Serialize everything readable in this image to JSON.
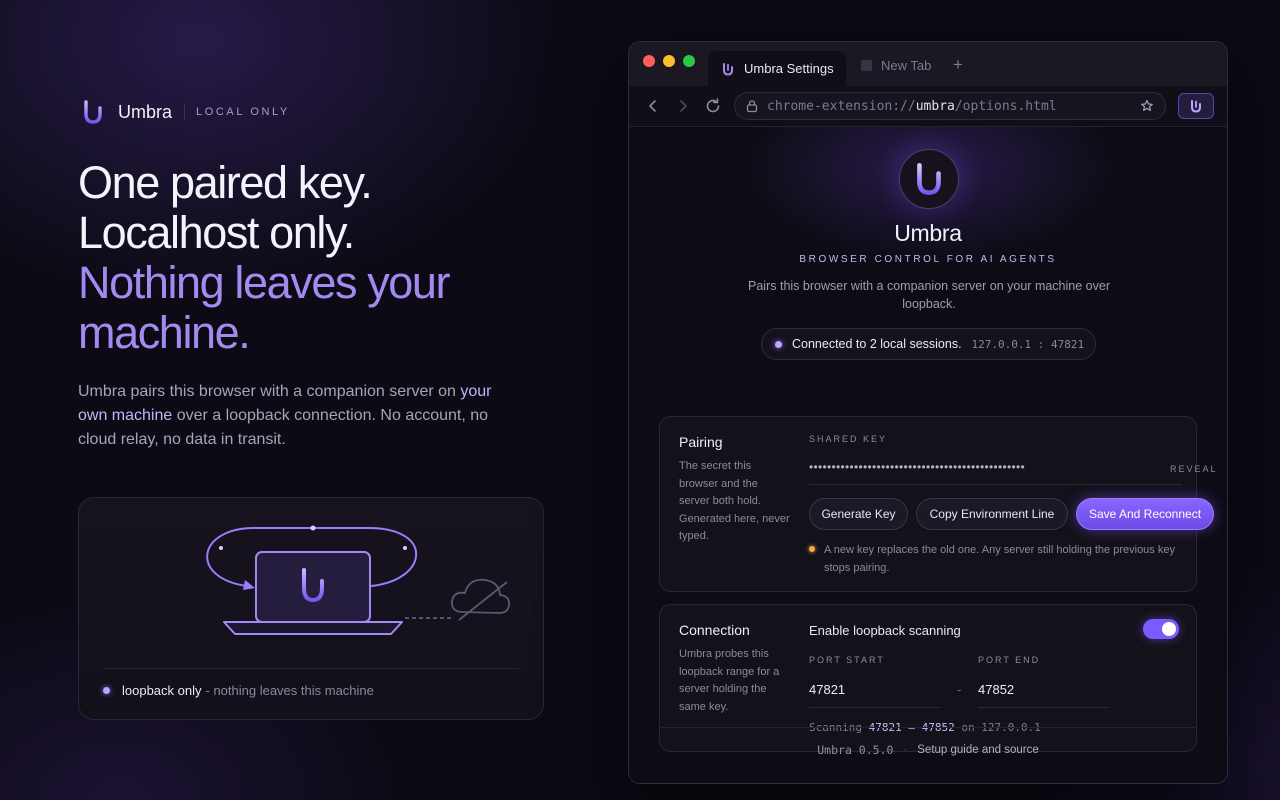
{
  "brand": {
    "name": "Umbra",
    "tag": "LOCAL ONLY"
  },
  "hero": {
    "line1": "One paired key.",
    "line2": "Localhost only.",
    "line3": "Nothing leaves your machine.",
    "lede_pre": "Umbra pairs this browser with a companion server on ",
    "lede_hl": "your own machine",
    "lede_post": " over a loopback connection. No account, no cloud relay, no data in transit."
  },
  "illustration": {
    "foot_strong": "loopback only",
    "foot_rest": "- nothing leaves this machine"
  },
  "browser": {
    "tabs": [
      {
        "label": "Umbra Settings",
        "active": true
      },
      {
        "label": "New Tab",
        "active": false
      }
    ],
    "new_tab": "+",
    "url": {
      "scheme": "chrome-extension://",
      "host": "umbra",
      "path": "/options.html"
    }
  },
  "page": {
    "title": "Umbra",
    "subtitle": "BROWSER CONTROL FOR AI AGENTS",
    "description": "Pairs this browser with a companion server on your machine over loopback.",
    "status": {
      "text": "Connected to 2 local sessions.",
      "address": "127.0.0.1 : 47821"
    },
    "pairing": {
      "title": "Pairing",
      "description": "The secret this browser and the server both hold. Generated here, never typed.",
      "key_label": "SHARED KEY",
      "key_masked": "••••••••••••••••••••••••••••••••••••••••••••••••",
      "reveal": "REVEAL",
      "buttons": {
        "generate": "Generate Key",
        "copy": "Copy Environment Line",
        "save": "Save And Reconnect"
      },
      "warning": "A new key replaces the old one. Any server still holding the previous key stops pairing."
    },
    "connection": {
      "title": "Connection",
      "description": "Umbra probes this loopback range for a server holding the same key.",
      "toggle_label": "Enable loopback scanning",
      "toggle_on": true,
      "port_start_label": "PORT START",
      "port_end_label": "PORT END",
      "port_start": "47821",
      "port_end": "47852",
      "range_sep": "-",
      "scan_pre": "Scanning",
      "scan_range": "47821 – 47852",
      "scan_mid": "on",
      "scan_host": "127.0.0.1"
    },
    "footer": {
      "version": "Umbra 0.5.0",
      "sep": "·",
      "link": "Setup guide and source"
    }
  },
  "colors": {
    "accent": "#8a66ff",
    "accent_light": "#a48af0",
    "warning": "#f0a93b",
    "background": "#0c0a14"
  },
  "icons": [
    "umbra-logo-icon",
    "back-icon",
    "forward-icon",
    "reload-icon",
    "lock-icon",
    "star-icon",
    "laptop-icon",
    "cloud-off-icon"
  ]
}
